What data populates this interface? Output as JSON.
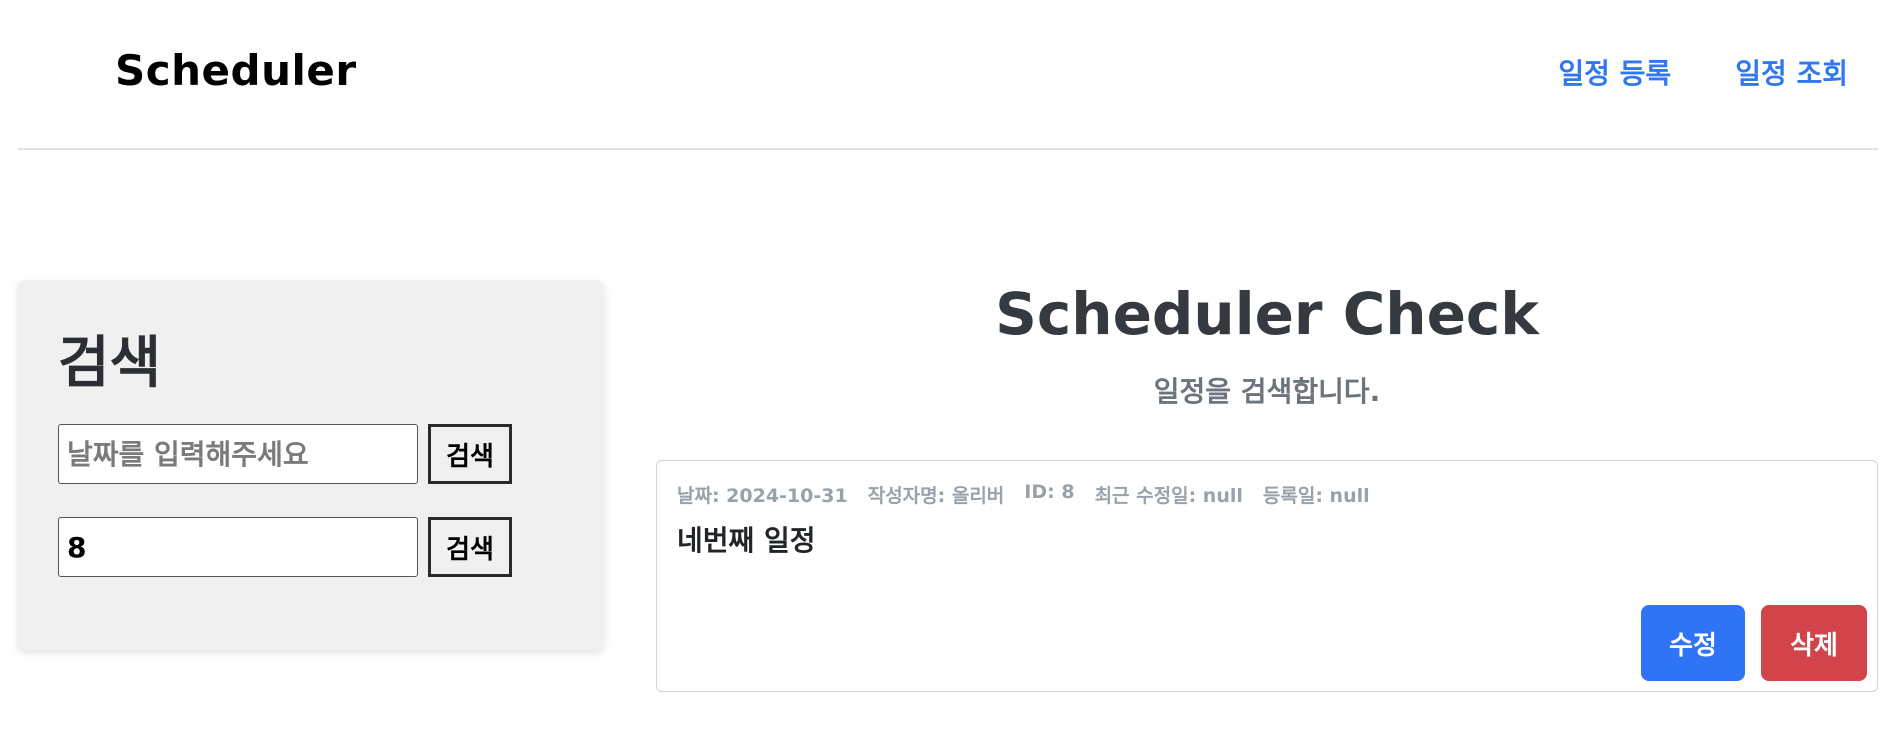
{
  "header": {
    "brand": "Scheduler",
    "nav": {
      "register": "일정 등록",
      "view": "일정 조회"
    }
  },
  "search": {
    "title": "검색",
    "date_input": {
      "placeholder": "날짜를 입력해주세요",
      "value": ""
    },
    "id_input": {
      "placeholder": "",
      "value": "8"
    },
    "button_label": "검색"
  },
  "main": {
    "title": "Scheduler Check",
    "subtitle": "일정을 검색합니다."
  },
  "schedule": {
    "meta": {
      "date": "날짜: 2024-10-31",
      "author": "작성자명: 올리버",
      "id": "ID: 8",
      "updated": "최근 수정일: null",
      "created": "등록일: null"
    },
    "title": "네번째 일정",
    "edit_label": "수정",
    "delete_label": "삭제"
  },
  "colors": {
    "accent": "#2f78f0",
    "edit_button": "#2f74f4",
    "delete_button": "#d2434a",
    "panel_bg": "#f0f0f0"
  }
}
